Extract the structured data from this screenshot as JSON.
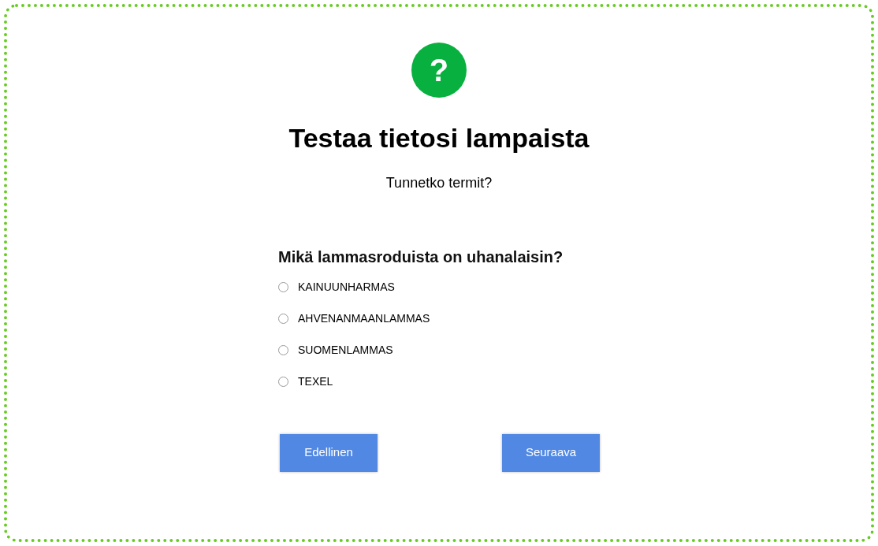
{
  "icon": {
    "symbol": "?"
  },
  "title": "Testaa tietosi lampaista",
  "subtitle": "Tunnetko termit?",
  "question": "Mikä lammasroduista on uhanalaisin?",
  "options": [
    {
      "label": "KAINUUNHARMAS",
      "selected": false
    },
    {
      "label": "AHVENANMAANLAMMAS",
      "selected": false
    },
    {
      "label": "SUOMENLAMMAS",
      "selected": false
    },
    {
      "label": "TEXEL",
      "selected": false
    }
  ],
  "buttons": [
    "Edellinen",
    "Seuraava"
  ]
}
